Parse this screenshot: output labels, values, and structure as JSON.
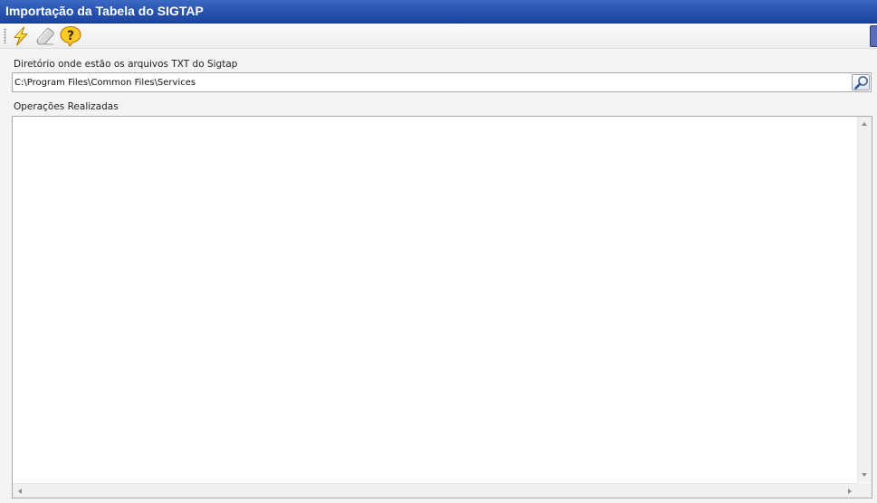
{
  "window": {
    "title": "Importação da Tabela do SIGTAP"
  },
  "toolbar": {
    "buttons": [
      {
        "name": "execute",
        "icon": "lightning-icon"
      },
      {
        "name": "clear",
        "icon": "eraser-icon"
      },
      {
        "name": "help",
        "icon": "help-question-icon"
      }
    ]
  },
  "directory": {
    "label": "Diretório onde estão os arquivos TXT do Sigtap",
    "value": "C:\\Program Files\\Common Files\\Services",
    "browse_icon": "magnifier-icon"
  },
  "operations": {
    "label": "Operações Realizadas",
    "content": ""
  },
  "colors": {
    "titlebar": "#2b55b0",
    "title_text": "#ffffff",
    "background": "#f4f4f4"
  }
}
